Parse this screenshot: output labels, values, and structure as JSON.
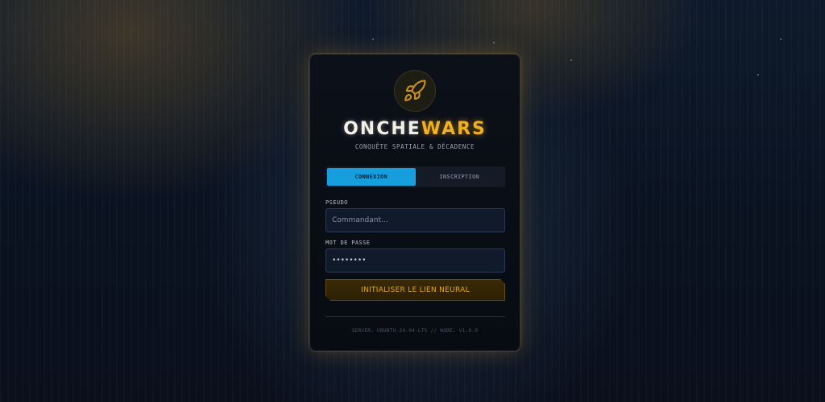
{
  "brand": {
    "title_part1": "ONCHE",
    "title_part2": "WARS",
    "subtitle": "CONQUÊTE SPATIALE & DÉCADENCE",
    "logo_icon": "rocket-icon",
    "accent_color": "#f0b020"
  },
  "tabs": [
    {
      "label": "CONNEXION",
      "active": true
    },
    {
      "label": "INSCRIPTION",
      "active": false
    }
  ],
  "form": {
    "pseudo": {
      "label": "PSEUDO",
      "placeholder": "Commandant..."
    },
    "password": {
      "label": "MOT DE PASSE",
      "value": "••••••••"
    },
    "submit_label": "INITIALISER LE LIEN NEURAL"
  },
  "footer": {
    "text": "SERVER: UBUNTU-24.04-LTS // NODE: V1.0.0"
  },
  "colors": {
    "tab_active": "#169fdc",
    "cta_text": "#e8a81c"
  }
}
